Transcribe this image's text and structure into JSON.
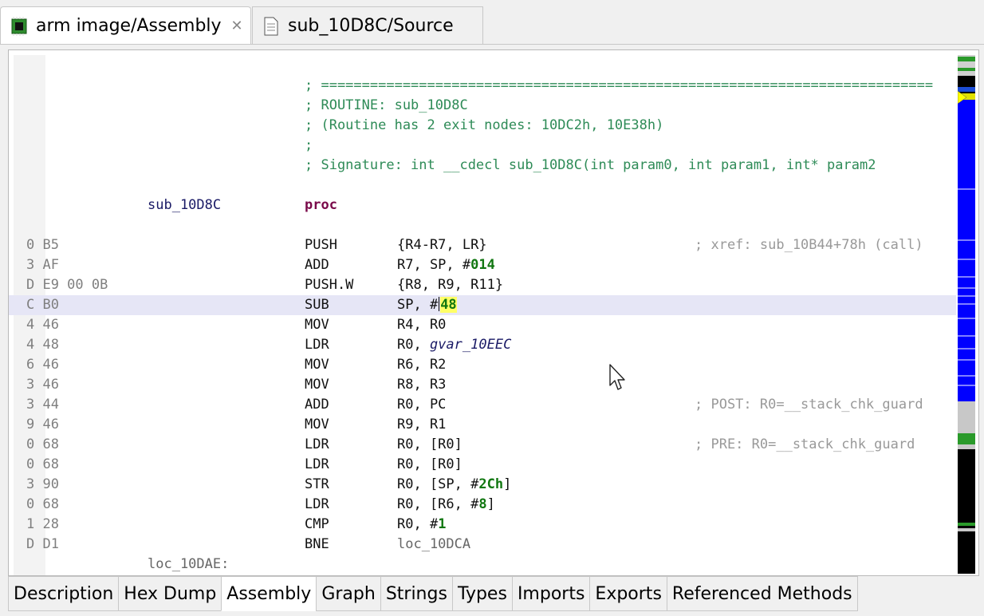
{
  "editor_tabs": [
    {
      "label": "arm image/Assembly",
      "icon": "chip-icon",
      "active": true
    },
    {
      "label": "sub_10D8C/Source",
      "icon": "document-icon",
      "active": false
    }
  ],
  "header_comments": [
    "; ===========================================================================",
    "; ROUTINE: sub_10D8C",
    "; (Routine has 2 exit nodes: 10DC2h, 10E38h)",
    ";",
    "; Signature: int __cdecl sub_10D8C(int param0, int param1, int* param2"
  ],
  "proc": {
    "label": "sub_10D8C",
    "keyword": "proc"
  },
  "instructions": [
    {
      "addr": "0 B5",
      "mnem": "PUSH",
      "ops": "{R4-R7, LR}",
      "comment": "; xref: sub_10B44+78h (call)"
    },
    {
      "addr": "3 AF",
      "mnem": "ADD",
      "ops_pre": "R7, SP, #",
      "num": "014"
    },
    {
      "addr": "D E9 00 0B",
      "mnem": "PUSH.W",
      "ops": "{R8, R9, R11}"
    },
    {
      "addr": "C B0",
      "mnem": "SUB",
      "ops_pre": "SP, #",
      "sel": "48"
    },
    {
      "addr": "4 46",
      "mnem": "MOV",
      "ops": "R4, R0"
    },
    {
      "addr": "4 48",
      "mnem": "LDR",
      "ops_pre": "R0, ",
      "gvar": "gvar_10EEC"
    },
    {
      "addr": "6 46",
      "mnem": "MOV",
      "ops": "R6, R2"
    },
    {
      "addr": "3 46",
      "mnem": "MOV",
      "ops": "R8, R3"
    },
    {
      "addr": "3 44",
      "mnem": "ADD",
      "ops": "R0, PC",
      "comment": "; POST: R0=__stack_chk_guard"
    },
    {
      "addr": "9 46",
      "mnem": "MOV",
      "ops": "R9, R1"
    },
    {
      "addr": "0 68",
      "mnem": "LDR",
      "ops": "R0, [R0]",
      "comment": "; PRE: R0=__stack_chk_guard"
    },
    {
      "addr": "0 68",
      "mnem": "LDR",
      "ops": "R0, [R0]"
    },
    {
      "addr": "3 90",
      "mnem": "STR",
      "ops_pre": "R0, [SP, #",
      "num": "2Ch",
      "ops_post": "]"
    },
    {
      "addr": "0 68",
      "mnem": "LDR",
      "ops_pre": "R0, [R6, #",
      "num": "8",
      "ops_post": "]"
    },
    {
      "addr": "1 28",
      "mnem": "CMP",
      "ops_pre": "R0, #",
      "num": "1"
    },
    {
      "addr": "D D1",
      "mnem": "BNE",
      "loc": "loc_10DCA"
    }
  ],
  "next_label": "loc_10DAE:",
  "bottom_tabs": [
    "Description",
    "Hex Dump",
    "Assembly",
    "Graph",
    "Strings",
    "Types",
    "Imports",
    "Exports",
    "Referenced Methods"
  ],
  "active_bottom_tab": "Assembly",
  "colors": {
    "comment_green": "#2e8b57",
    "number_green": "#117711",
    "highlight_row": "#e6e6f6",
    "overview_blue": "#0000ff"
  }
}
